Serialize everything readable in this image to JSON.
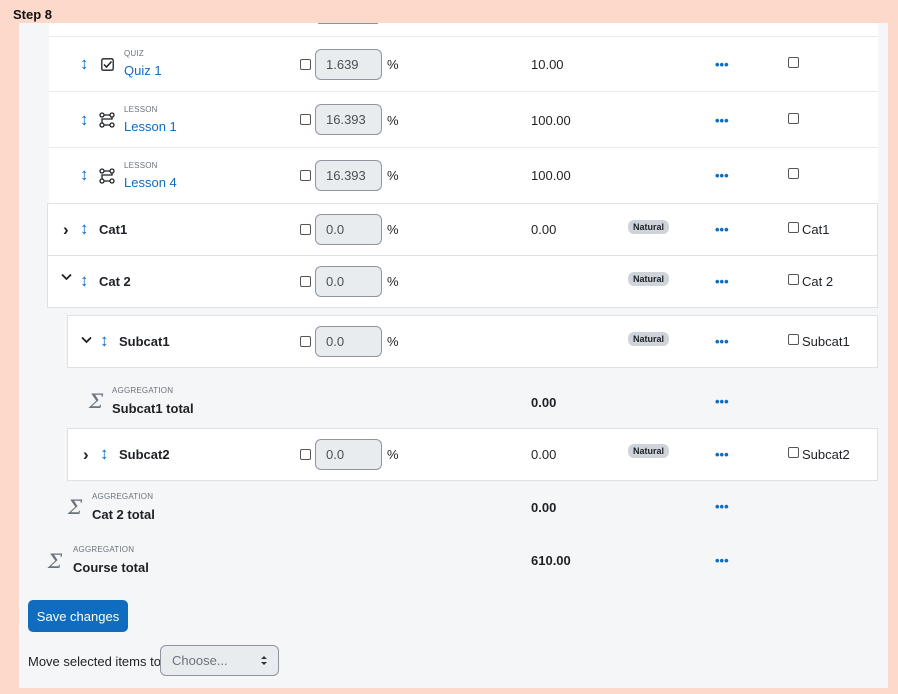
{
  "step_label": "Step 8",
  "unit": "%",
  "rows": {
    "quiz1": {
      "module": "QUIZ",
      "name": "Quiz 1",
      "weight": "1.639",
      "max": "10.00"
    },
    "lesson1": {
      "module": "LESSON",
      "name": "Lesson 1",
      "weight": "16.393",
      "max": "100.00"
    },
    "lesson4": {
      "module": "LESSON",
      "name": "Lesson 4",
      "weight": "16.393",
      "max": "100.00"
    },
    "cat1": {
      "name": "Cat1",
      "weight": "0.0",
      "max": "0.00",
      "badge": "Natural",
      "check_label": "Cat1"
    },
    "cat2": {
      "name": "Cat 2",
      "weight": "0.0",
      "badge": "Natural",
      "check_label": "Cat 2"
    },
    "subcat1": {
      "name": "Subcat1",
      "weight": "0.0",
      "badge": "Natural",
      "check_label": "Subcat1"
    },
    "subcat1_total": {
      "module": "AGGREGATION",
      "name": "Subcat1 total",
      "max": "0.00"
    },
    "subcat2": {
      "name": "Subcat2",
      "weight": "0.0",
      "max": "0.00",
      "badge": "Natural",
      "check_label": "Subcat2"
    },
    "cat2_total": {
      "module": "AGGREGATION",
      "name": "Cat 2 total",
      "max": "0.00"
    },
    "course_total": {
      "module": "AGGREGATION",
      "name": "Course total",
      "max": "610.00"
    }
  },
  "actions_glyph": "•••",
  "save_label": "Save changes",
  "move": {
    "label": "Move selected items to",
    "placeholder": "Choose..."
  },
  "icons": {
    "move": "↕",
    "expand": "›",
    "collapse": "⌄",
    "sigma": "Σ",
    "select_arrow": "⬍"
  }
}
